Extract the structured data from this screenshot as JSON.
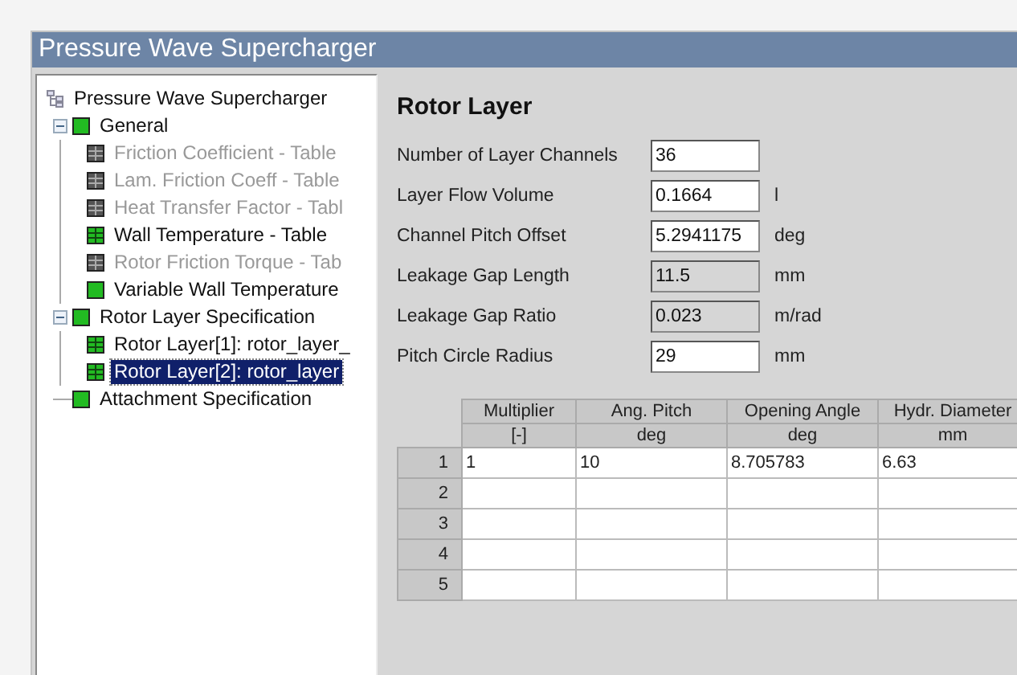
{
  "window": {
    "title": "Pressure Wave Supercharger"
  },
  "tree": {
    "label": "Pressure Wave Supercharger",
    "kind": "root",
    "children": [
      {
        "label": "General",
        "kind": "node",
        "enabled": true,
        "expanded": true,
        "selected": false,
        "children": [
          {
            "label": "Friction Coefficient - Table",
            "kind": "table",
            "enabled": false,
            "selected": false
          },
          {
            "label": "Lam. Friction Coeff - Table",
            "kind": "table",
            "enabled": false,
            "selected": false
          },
          {
            "label": "Heat Transfer Factor - Tabl",
            "kind": "table",
            "enabled": false,
            "selected": false
          },
          {
            "label": "Wall Temperature - Table",
            "kind": "table",
            "enabled": true,
            "selected": false
          },
          {
            "label": "Rotor Friction Torque - Tab",
            "kind": "table",
            "enabled": false,
            "selected": false
          },
          {
            "label": "Variable Wall Temperature",
            "kind": "node",
            "enabled": true,
            "selected": false
          }
        ]
      },
      {
        "label": "Rotor Layer Specification",
        "kind": "node",
        "enabled": true,
        "expanded": true,
        "selected": false,
        "children": [
          {
            "label": "Rotor Layer[1]: rotor_layer_",
            "kind": "table",
            "enabled": true,
            "selected": false
          },
          {
            "label": "Rotor Layer[2]: rotor_layer",
            "kind": "table",
            "enabled": true,
            "selected": true
          }
        ]
      },
      {
        "label": "Attachment Specification",
        "kind": "node",
        "enabled": true,
        "selected": false
      }
    ]
  },
  "panel": {
    "heading": "Rotor Layer",
    "fields": [
      {
        "label": "Number of Layer Channels",
        "value": "36",
        "editable": true
      },
      {
        "label": "Layer Flow Volume",
        "value": "0.1664",
        "unit": "l",
        "editable": true
      },
      {
        "label": "Channel Pitch Offset",
        "value": "5.2941175",
        "unit": "deg",
        "editable": true
      },
      {
        "label": "Leakage Gap Length",
        "value": "11.5",
        "unit": "mm",
        "editable": false
      },
      {
        "label": "Leakage Gap Ratio",
        "value": "0.023",
        "unit": "m/rad",
        "editable": false
      },
      {
        "label": "Pitch Circle Radius",
        "value": "29",
        "unit": "mm",
        "editable": true
      }
    ],
    "table": {
      "columns": [
        {
          "name": "Multiplier",
          "unit": "[-]"
        },
        {
          "name": "Ang. Pitch",
          "unit": "deg"
        },
        {
          "name": "Opening Angle",
          "unit": "deg"
        },
        {
          "name": "Hydr. Diameter",
          "unit": "mm"
        }
      ],
      "rows": [
        {
          "index": "1",
          "cells": [
            "1",
            "10",
            "8.705783",
            "6.63"
          ]
        },
        {
          "index": "2"
        },
        {
          "index": "3"
        },
        {
          "index": "4"
        },
        {
          "index": "5"
        }
      ]
    }
  }
}
